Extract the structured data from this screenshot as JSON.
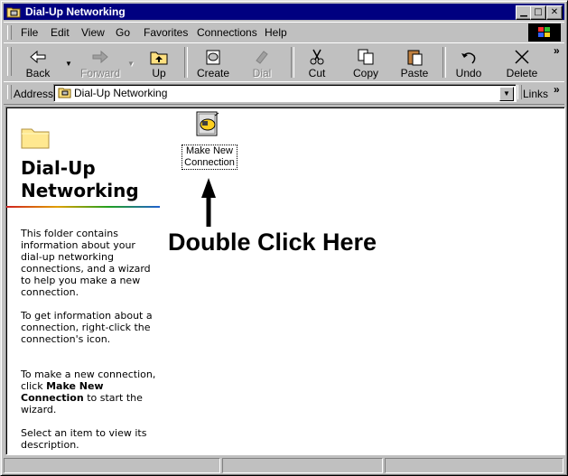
{
  "window": {
    "title": "Dial-Up Networking"
  },
  "menu": [
    "File",
    "Edit",
    "View",
    "Go",
    "Favorites",
    "Connections",
    "Help"
  ],
  "toolbar": {
    "back": "Back",
    "forward": "Forward",
    "up": "Up",
    "create": "Create",
    "dial": "Dial",
    "cut": "Cut",
    "copy": "Copy",
    "paste": "Paste",
    "undo": "Undo",
    "delete": "Delete",
    "more": "»"
  },
  "address": {
    "label": "Address",
    "value": "Dial-Up Networking",
    "links": "Links",
    "links_more": "»"
  },
  "left_panel": {
    "heading_line1": "Dial-Up",
    "heading_line2": "Networking",
    "para1": "This folder contains information about your dial-up networking connections, and a wizard to help you make a new connection.",
    "para2": "To get information about a connection, right-click the connection's icon.",
    "para3_pre": "To make a new connection, click ",
    "para3_bold": "Make New Connection",
    "para3_post": " to start the wizard.",
    "para4": "Select an item to view its description."
  },
  "icons": {
    "make_new_line1": "Make New",
    "make_new_line2": "Connection"
  },
  "annotation": {
    "text": "Double Click Here"
  },
  "colors": {
    "titlebar": "#000080",
    "face": "#c0c0c0"
  }
}
